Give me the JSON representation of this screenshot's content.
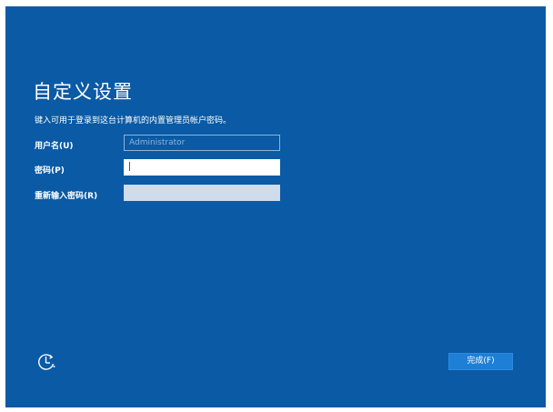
{
  "page": {
    "title": "自定义设置",
    "subtitle": "键入可用于登录到这台计算机的内置管理员帐户密码。"
  },
  "form": {
    "username_label": "用户名(U)",
    "username_value": "Administrator",
    "password_label": "密码(P)",
    "password_value": "",
    "confirm_label": "重新输入密码(R)",
    "confirm_value": ""
  },
  "footer": {
    "accessibility_icon": "ease-of-access-icon",
    "finish_label": "完成(F)"
  },
  "colors": {
    "background": "#0a5aa5",
    "button": "#1e7fd6",
    "text": "#ffffff"
  }
}
